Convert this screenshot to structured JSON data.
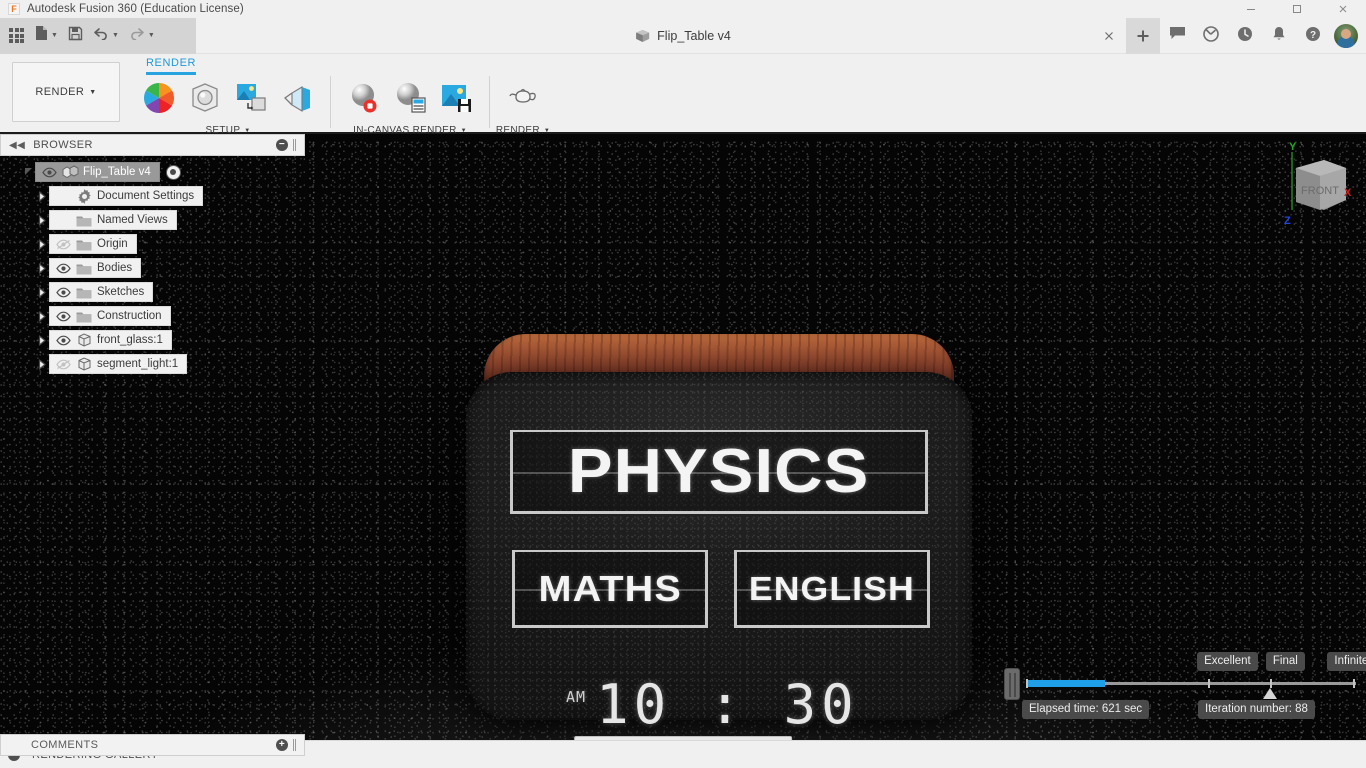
{
  "window": {
    "app_title": "Autodesk Fusion 360 (Education License)",
    "app_icon": "F",
    "minimize": "minimize-icon",
    "maximize": "maximize-icon",
    "close": "close-icon"
  },
  "quick_access": {
    "grid_icon": "app-grid-icon",
    "new_icon": "new-document-icon",
    "save_icon": "save-icon",
    "undo_icon": "undo-icon",
    "redo_icon": "redo-icon",
    "caret": "▼"
  },
  "document_tab": {
    "title": "Flip_Table v4",
    "icon": "cube-icon",
    "close_label": "×",
    "add_label": "+"
  },
  "tab_tools": [
    {
      "name": "comments-icon"
    },
    {
      "name": "job-status-icon"
    },
    {
      "name": "recent-icon"
    },
    {
      "name": "notifications-bell-icon"
    },
    {
      "name": "help-icon"
    }
  ],
  "ribbon": {
    "workspace": "RENDER",
    "workspace_caret": "▼",
    "active_tab": "RENDER",
    "panels": [
      {
        "label": "SETUP",
        "caret": "▼",
        "buttons": [
          {
            "name": "appearance-button"
          },
          {
            "name": "scene-settings-button"
          },
          {
            "name": "texture-map-controls-button"
          },
          {
            "name": "decal-button"
          }
        ]
      },
      {
        "label": "IN-CANVAS RENDER",
        "caret": "▼",
        "buttons": [
          {
            "name": "in-canvas-render-button"
          },
          {
            "name": "in-canvas-render-settings-button"
          },
          {
            "name": "capture-image-button"
          }
        ]
      },
      {
        "label": "RENDER",
        "caret": "▼",
        "buttons": [
          {
            "name": "render-button"
          }
        ]
      }
    ]
  },
  "browser": {
    "header": "BROWSER",
    "collapse_icon": "collapse-left-icon",
    "minus_label": "−",
    "nodes": [
      {
        "label": "Flip_Table v4",
        "icon": "component-icon",
        "eye": "visible",
        "selected": true,
        "expanded": true,
        "has_target": true
      },
      {
        "label": "Document Settings",
        "icon": "gear-icon",
        "eye": "none",
        "selected": false,
        "expanded": false,
        "has_target": false
      },
      {
        "label": "Named Views",
        "icon": "folder-icon",
        "eye": "none",
        "selected": false,
        "expanded": false,
        "has_target": false
      },
      {
        "label": "Origin",
        "icon": "folder-icon",
        "eye": "hidden",
        "selected": false,
        "expanded": false,
        "has_target": false
      },
      {
        "label": "Bodies",
        "icon": "folder-icon",
        "eye": "visible",
        "selected": false,
        "expanded": false,
        "has_target": false
      },
      {
        "label": "Sketches",
        "icon": "folder-icon",
        "eye": "visible",
        "selected": false,
        "expanded": false,
        "has_target": false
      },
      {
        "label": "Construction",
        "icon": "folder-icon",
        "eye": "visible",
        "selected": false,
        "expanded": false,
        "has_target": false
      },
      {
        "label": "front_glass:1",
        "icon": "body-icon",
        "eye": "visible",
        "selected": false,
        "expanded": false,
        "has_target": false
      },
      {
        "label": "segment_light:1",
        "icon": "body-icon",
        "eye": "hidden",
        "selected": false,
        "expanded": false,
        "has_target": false
      }
    ]
  },
  "viewcube": {
    "face": "FRONT",
    "axis_y": "Y",
    "axis_x": "X",
    "axis_z": "Z",
    "color_y": "#22aa22",
    "color_x": "#cc2222",
    "color_z": "#2244dd"
  },
  "canvas": {
    "device": {
      "flap_top": "PHYSICS",
      "flap_left": "MATHS",
      "flap_right": "ENGLISH",
      "clock_ampm": "AM",
      "clock_time": "10 : 30",
      "wood_color": "#b5563a",
      "body_color": "#1d1d1d"
    }
  },
  "render_hud": {
    "quality_marks": [
      {
        "label": "Excellent",
        "left_pct": 55
      },
      {
        "label": "Final",
        "left_pct": 74
      },
      {
        "label": "Infinite",
        "left_pct": 91
      }
    ],
    "progress_pct": 24,
    "slider_position_pct": 74,
    "elapsed_time": "Elapsed time: 621 sec",
    "iteration_number": "Iteration number: 88",
    "accent_color": "#1e9fe8"
  },
  "navbar": [
    {
      "name": "orbit-icon",
      "caret": true
    },
    {
      "name": "look-at-icon",
      "caret": false
    },
    {
      "name": "pan-hand-icon",
      "caret": false
    },
    {
      "name": "zoom-icon",
      "caret": false
    },
    {
      "name": "zoom-window-icon",
      "caret": true
    },
    {
      "name": "display-settings-icon",
      "caret": true
    },
    {
      "name": "grid-snap-icon",
      "caret": true
    }
  ],
  "footer": {
    "comments": "COMMENTS",
    "comments_plus": "+",
    "gallery": "RENDERING GALLERY",
    "gallery_plus": "+"
  }
}
